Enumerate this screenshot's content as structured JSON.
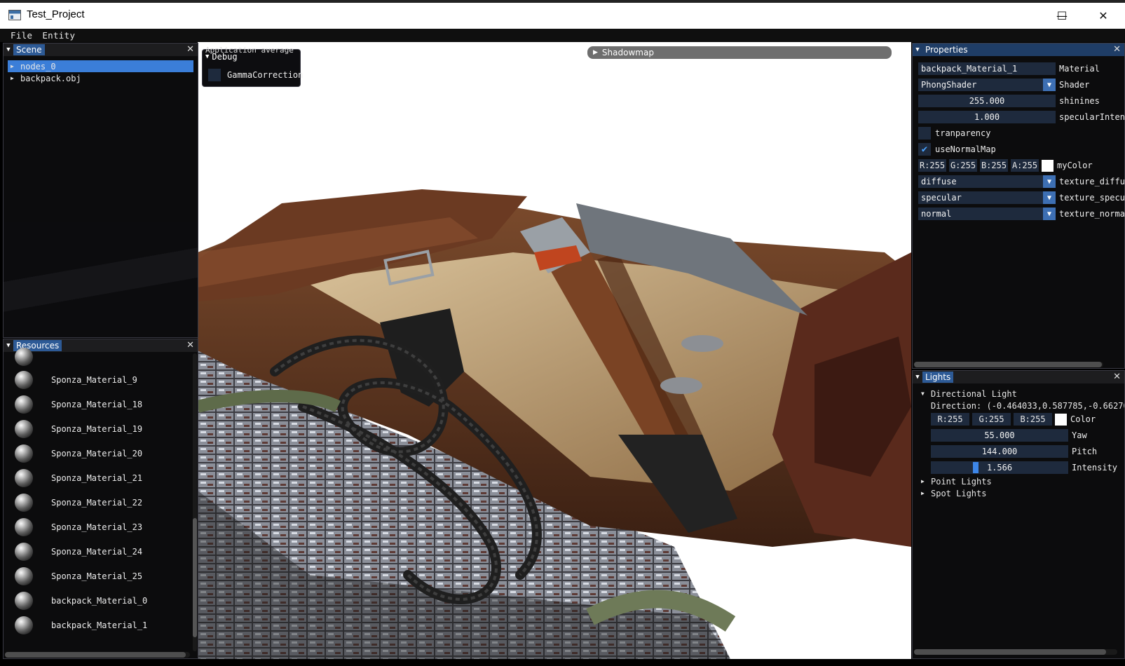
{
  "window": {
    "title": "Test_Project",
    "minimize_glyph": "—",
    "maximize_glyph": "☐",
    "close_glyph": "✕"
  },
  "menu": [
    "File",
    "Entity"
  ],
  "scene": {
    "title": "Scene",
    "items": [
      {
        "label": "nodes_0",
        "selected": true
      },
      {
        "label": "backpack.obj",
        "selected": false
      }
    ]
  },
  "resources": {
    "title": "Resources",
    "items": [
      "Sponza_Material_9",
      "Sponza_Material_18",
      "Sponza_Material_19",
      "Sponza_Material_20",
      "Sponza_Material_21",
      "Sponza_Material_22",
      "Sponza_Material_23",
      "Sponza_Material_24",
      "Sponza_Material_25",
      "backpack_Material_0",
      "backpack_Material_1"
    ]
  },
  "debug": {
    "overlay_text": "Application average",
    "title": "Debug",
    "gamma_label": "GammaCorrection"
  },
  "shadowmap": {
    "label": "Shadowmap"
  },
  "properties": {
    "title": "Properties",
    "material_value": "backpack_Material_1",
    "material_label": "Material",
    "shader_value": "PhongShader",
    "shader_label": "Shader",
    "shininess_value": "255.000",
    "shininess_label": "shinines",
    "specular_value": "1.000",
    "specular_label": "specularInten",
    "transparency_label": "tranparency",
    "use_normal_map_label": "useNormalMap",
    "color_r": "R:255",
    "color_g": "G:255",
    "color_b": "B:255",
    "color_a": "A:255",
    "color_label": "myColor",
    "diffuse_value": "diffuse",
    "diffuse_label": "texture_diffu",
    "specular_tex_value": "specular",
    "specular_tex_label": "texture_specu",
    "normal_value": "normal",
    "normal_label": "texture_norma"
  },
  "lights": {
    "title": "Lights",
    "directional_label": "Directional Light",
    "direction_text": "Direction: (-0.464033,0.587785,-0.66270",
    "r": "R:255",
    "g": "G:255",
    "b": "B:255",
    "color_label": "Color",
    "yaw_value": "55.000",
    "yaw_label": "Yaw",
    "pitch_value": "144.000",
    "pitch_label": "Pitch",
    "intensity_value": "1.566",
    "intensity_label": "Intensity",
    "intensity_fraction": 0.32,
    "point_lights_label": "Point Lights",
    "spot_lights_label": "Spot Lights"
  }
}
